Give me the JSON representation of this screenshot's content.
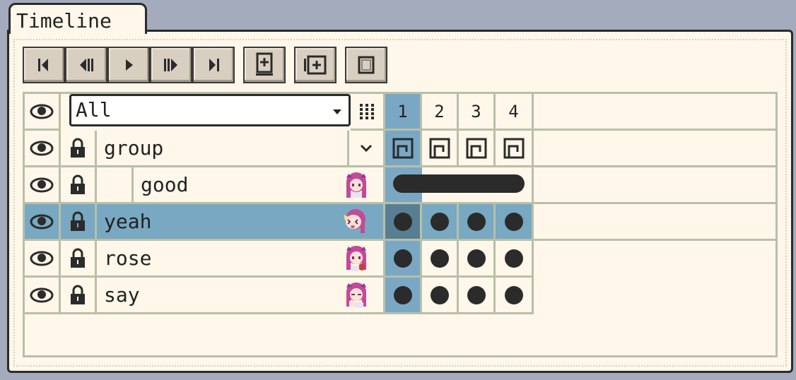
{
  "panel": {
    "title": "Timeline"
  },
  "toolbar": {
    "buttons": [
      {
        "name": "first-frame-button",
        "icon": "first-frame-icon"
      },
      {
        "name": "prev-frame-button",
        "icon": "prev-frame-icon"
      },
      {
        "name": "play-button",
        "icon": "play-icon"
      },
      {
        "name": "next-frame-button",
        "icon": "next-frame-icon"
      },
      {
        "name": "last-frame-button",
        "icon": "last-frame-icon"
      },
      {
        "name": "new-frame-button",
        "icon": "new-frame-icon"
      },
      {
        "name": "duplicate-frame-button",
        "icon": "duplicate-frame-icon"
      },
      {
        "name": "frame-button",
        "icon": "frame-icon"
      }
    ]
  },
  "layer_filter": {
    "selected": "All"
  },
  "frames": [
    "1",
    "2",
    "3",
    "4"
  ],
  "layers": [
    {
      "name": "group",
      "type": "group",
      "indent": false,
      "selected": false
    },
    {
      "name": "good",
      "type": "layer",
      "indent": true,
      "selected": false
    },
    {
      "name": "yeah",
      "type": "layer",
      "indent": false,
      "selected": true
    },
    {
      "name": "rose",
      "type": "layer",
      "indent": false,
      "selected": false
    },
    {
      "name": "say",
      "type": "layer",
      "indent": false,
      "selected": false
    }
  ],
  "colors": {
    "selected_row": "#78a8c2",
    "current_frame": "#7aa8c4",
    "panel_bg": "#fef7ea",
    "grid_line": "#b8c0a8"
  }
}
